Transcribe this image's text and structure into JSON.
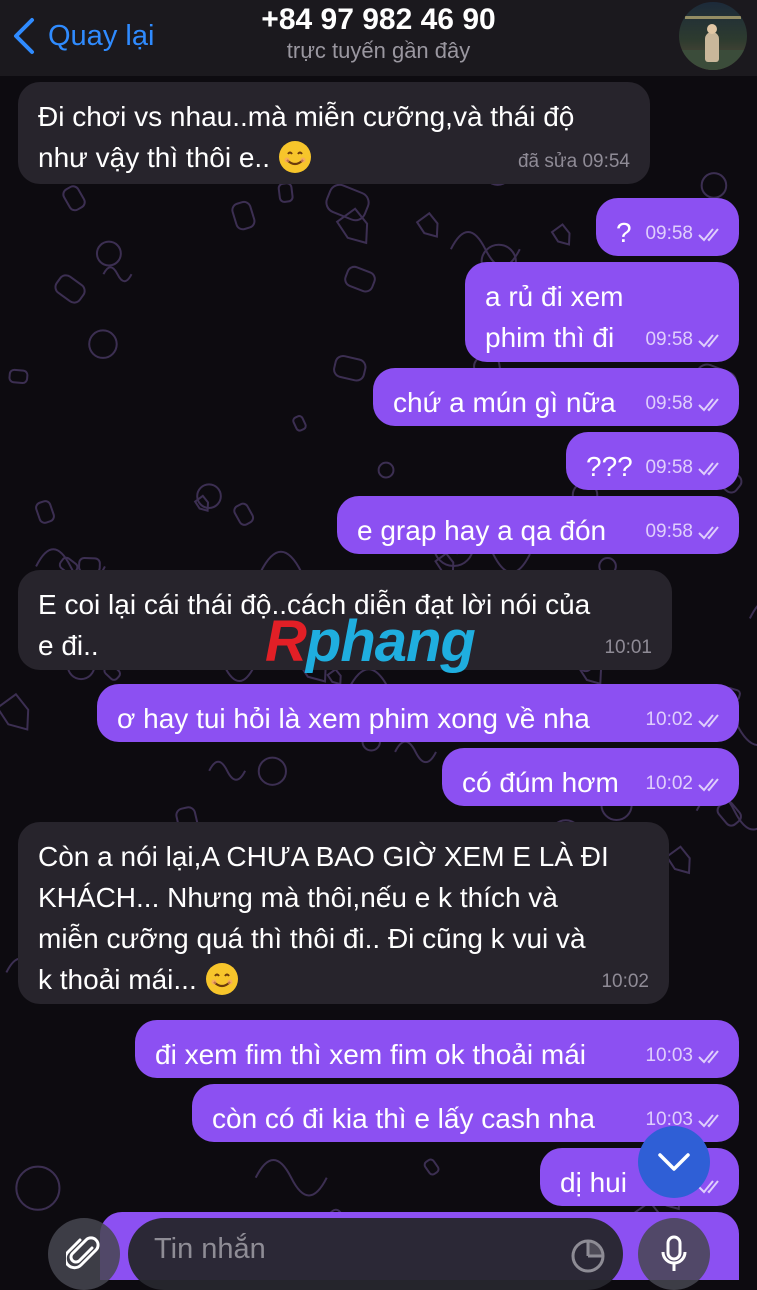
{
  "header": {
    "back_label": "Quay lại",
    "contact_name": "+84 97 982 46 90",
    "contact_status": "trực tuyến gần đây"
  },
  "messages": [
    {
      "direction": "in",
      "text": "Đi chơi vs nhau..mà miễn cưỡng,và thái độ\nnhư vậy thì thôi e.. ",
      "emoji": true,
      "time": "đã sửa 09:54"
    },
    {
      "direction": "out",
      "text": "?",
      "time": "09:58",
      "read": true
    },
    {
      "direction": "out",
      "text": "a rủ đi xem\nphim thì đi",
      "time": "09:58",
      "read": true
    },
    {
      "direction": "out",
      "text": "chứ a mún gì nữa",
      "time": "09:58",
      "read": true
    },
    {
      "direction": "out",
      "text": "???",
      "time": "09:58",
      "read": true
    },
    {
      "direction": "out",
      "text": "e grap hay a qa đón",
      "time": "09:58",
      "read": true
    },
    {
      "direction": "in",
      "text": "E coi lại cái thái độ..cách diễn đạt lời nói của\ne đi..",
      "time": "10:01"
    },
    {
      "direction": "out",
      "text": "ơ hay tui hỏi là xem phim xong về nha",
      "time": "10:02",
      "read": true
    },
    {
      "direction": "out",
      "text": "có đúm hơm",
      "time": "10:02",
      "read": true
    },
    {
      "direction": "in",
      "text": "Còn a nói lại,A CHƯA BAO GIỜ XEM E LÀ ĐI\nKHÁCH...  Nhưng mà thôi,nếu e k thích và\nmiễn cưỡng quá thì thôi đi.. Đi cũng k vui và\nk thoải mái... ",
      "emoji": true,
      "time": "10:02"
    },
    {
      "direction": "out",
      "text": "đi xem fim thì xem fim ok thoải mái",
      "time": "10:03",
      "read": true
    },
    {
      "direction": "out",
      "text": "còn có đi kia thì e lấy cash nha",
      "time": "10:03",
      "read": true
    },
    {
      "direction": "out",
      "text": "dị hui",
      "time": "",
      "read": true
    }
  ],
  "watermark": {
    "first": "R",
    "rest": "phang"
  },
  "composer": {
    "placeholder": "Tin nhắn"
  },
  "colors": {
    "incoming": "#27242c",
    "outgoing": "#8c50f2",
    "accent": "#2f8bff",
    "background": "#0d0b10"
  },
  "icons": [
    "chevron-left-icon",
    "double-check-icon",
    "smile-emoji-icon",
    "chevron-down-icon",
    "paperclip-icon",
    "sticker-icon",
    "microphone-icon"
  ]
}
